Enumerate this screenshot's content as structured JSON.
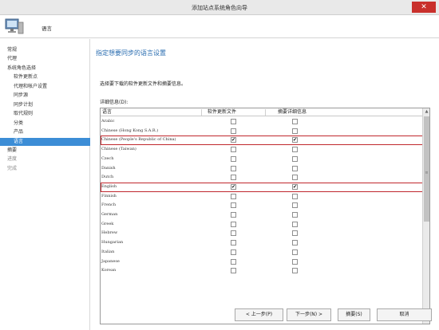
{
  "window": {
    "title": "添加站点系统角色向导",
    "close_glyph": "✕"
  },
  "header": {
    "title": "语言"
  },
  "nav": {
    "items": [
      {
        "label": "常规",
        "level": "top"
      },
      {
        "label": "代理",
        "level": "top"
      },
      {
        "label": "系统角色选择",
        "level": "top"
      },
      {
        "label": "软件更新点",
        "level": "sub"
      },
      {
        "label": "代理和帐户设置",
        "level": "sub"
      },
      {
        "label": "同步源",
        "level": "sub"
      },
      {
        "label": "同步计划",
        "level": "sub"
      },
      {
        "label": "取代规则",
        "level": "sub"
      },
      {
        "label": "分类",
        "level": "sub"
      },
      {
        "label": "产品",
        "level": "sub"
      },
      {
        "label": "语言",
        "level": "sub",
        "active": true
      },
      {
        "label": "摘要",
        "level": "top"
      },
      {
        "label": "进度",
        "level": "top",
        "dim": true
      },
      {
        "label": "完成",
        "level": "top",
        "dim": true
      }
    ]
  },
  "main": {
    "heading": "指定想要同步的语言设置",
    "instruction": "选择要下载的软件更新文件和摘要信息。",
    "details_label": "详细信息(D):",
    "table": {
      "columns": [
        "语言",
        "软件更新文件",
        "摘要详细信息"
      ],
      "rows": [
        {
          "language": "Arabic",
          "files": false,
          "summary": false
        },
        {
          "language": "Chinese (Hong Kong S.A.R.)",
          "files": false,
          "summary": false
        },
        {
          "language": "Chinese (People's Republic of China)",
          "files": true,
          "summary": true,
          "highlighted": true
        },
        {
          "language": "Chinese (Taiwan)",
          "files": false,
          "summary": false
        },
        {
          "language": "Czech",
          "files": false,
          "summary": false
        },
        {
          "language": "Danish",
          "files": false,
          "summary": false
        },
        {
          "language": "Dutch",
          "files": false,
          "summary": false
        },
        {
          "language": "English",
          "files": true,
          "summary": true,
          "highlighted": true
        },
        {
          "language": "Finnish",
          "files": false,
          "summary": false
        },
        {
          "language": "French",
          "files": false,
          "summary": false
        },
        {
          "language": "German",
          "files": false,
          "summary": false
        },
        {
          "language": "Greek",
          "files": false,
          "summary": false
        },
        {
          "language": "Hebrew",
          "files": false,
          "summary": false
        },
        {
          "language": "Hungarian",
          "files": false,
          "summary": false
        },
        {
          "language": "Italian",
          "files": false,
          "summary": false
        },
        {
          "language": "Japanese",
          "files": false,
          "summary": false
        },
        {
          "language": "Korean",
          "files": false,
          "summary": false
        }
      ],
      "check_glyph": "✔"
    }
  },
  "footer": {
    "prev_label": "< 上一步(P)",
    "next_label": "下一步(N) >",
    "summary_label": "摘要(S)",
    "cancel_label": "取消"
  }
}
